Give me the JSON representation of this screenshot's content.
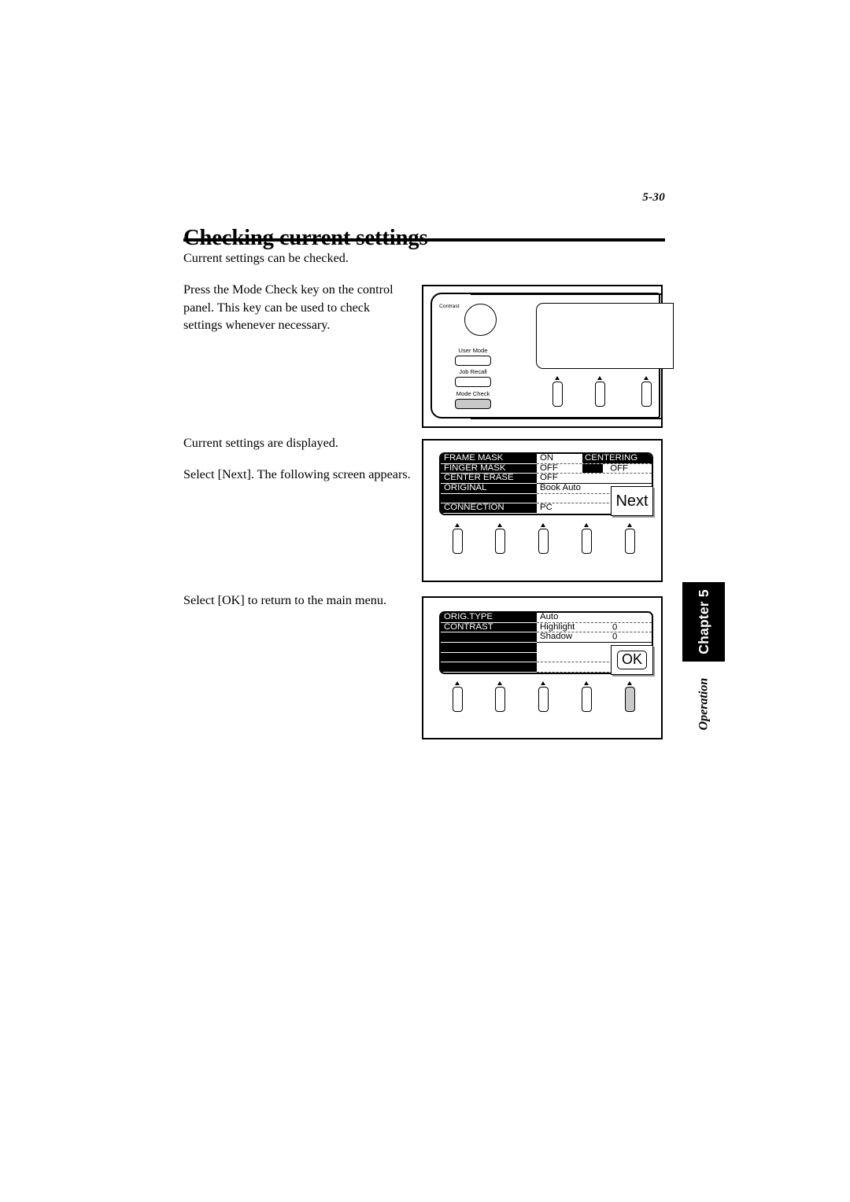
{
  "header": {
    "page_number": "5-30",
    "title": "Checking current settings"
  },
  "body": {
    "p_intro": "Current settings can be checked.",
    "p_press": "Press the Mode Check key on the control panel. This key can be used to check settings whenever necessary.",
    "p_displayed": "Current settings are displayed.",
    "p_next": "Select [Next]. The following screen appears.",
    "p_ok": "Select [OK] to return to the main menu."
  },
  "control_panel": {
    "knob_label": "Contrast",
    "keys": [
      {
        "label": "User Mode",
        "active": false
      },
      {
        "label": "Job Recall",
        "active": false
      },
      {
        "label": "Mode Check",
        "active": true
      }
    ]
  },
  "screen_one": {
    "rows": [
      {
        "label": "FRAME MASK",
        "value": "ON",
        "extra_label": "CENTERING",
        "extra_value": ""
      },
      {
        "label": "FINGER MASK",
        "value": "OFF",
        "extra_label": "",
        "extra_value": "OFF"
      },
      {
        "label": "CENTER ERASE",
        "value": "OFF",
        "extra_label": "",
        "extra_value": ""
      },
      {
        "label": "ORIGINAL",
        "value": "Book Auto",
        "extra_label": "",
        "extra_value": ""
      },
      {
        "label": "",
        "value": "",
        "extra_label": "",
        "extra_value": ""
      },
      {
        "label": "CONNECTION",
        "value": "PC",
        "extra_label": "",
        "extra_value": ""
      }
    ],
    "button_label": "Next"
  },
  "screen_two": {
    "rows": [
      {
        "label": "ORIG.TYPE",
        "value": "Auto",
        "number": ""
      },
      {
        "label": "CONTRAST",
        "value": "Highlight",
        "number": "0"
      },
      {
        "label": "",
        "value": "Shadow",
        "number": "0"
      },
      {
        "label": "",
        "value": "",
        "number": ""
      },
      {
        "label": "",
        "value": "",
        "number": ""
      },
      {
        "label": "",
        "value": "",
        "number": ""
      }
    ],
    "button_label": "OK"
  },
  "side_tab": {
    "chapter": "Chapter 5",
    "section": "Operation"
  }
}
